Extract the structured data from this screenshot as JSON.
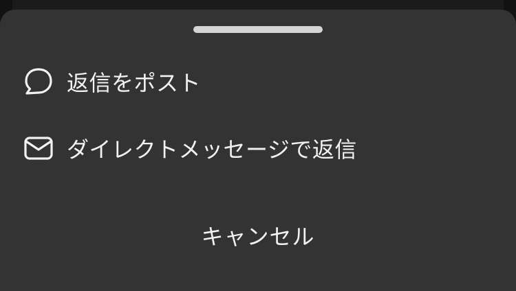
{
  "sheet": {
    "actions": [
      {
        "label": "返信をポスト",
        "icon": "speech-bubble-icon"
      },
      {
        "label": "ダイレクトメッセージで返信",
        "icon": "envelope-icon"
      }
    ],
    "cancel_label": "キャンセル"
  },
  "colors": {
    "sheet_background": "#333333",
    "backdrop": "#121212",
    "text": "#f2f2f2",
    "grabber": "#d4d4d4"
  }
}
